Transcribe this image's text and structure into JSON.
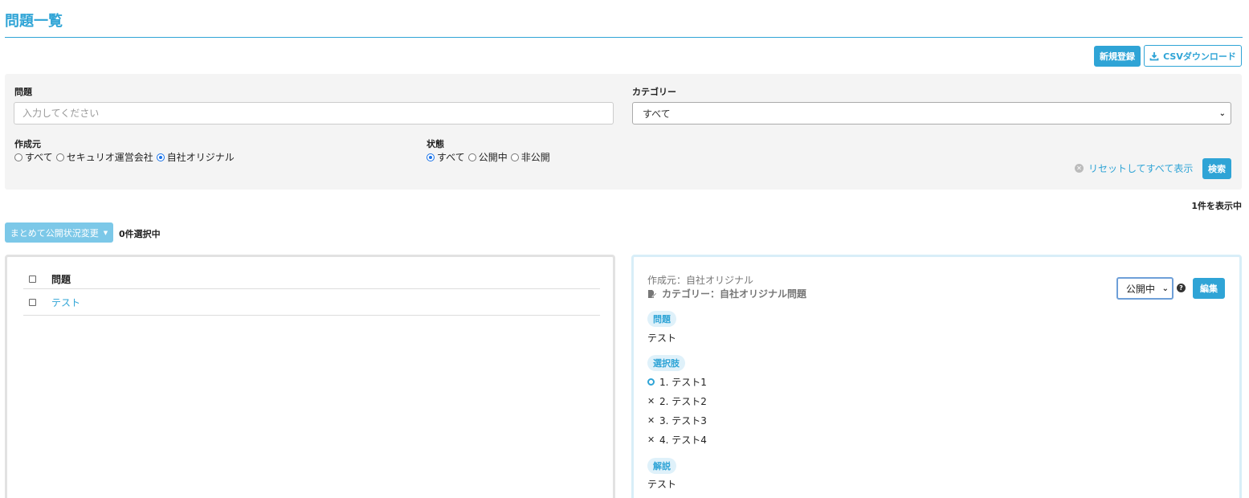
{
  "page": {
    "title": "問題一覧"
  },
  "toolbar": {
    "new_label": "新規登録",
    "csv_label": "CSVダウンロード"
  },
  "search": {
    "question_label": "問題",
    "question_placeholder": "入力してください",
    "category_label": "カテゴリー",
    "category_selected": "すべて",
    "creator_label": "作成元",
    "creator_options": [
      "すべて",
      "セキュリオ運営会社",
      "自社オリジナル"
    ],
    "creator_selected_index": 2,
    "status_label": "状態",
    "status_options": [
      "すべて",
      "公開中",
      "非公開"
    ],
    "status_selected_index": 0,
    "reset_label": "リセットしてすべて表示",
    "search_label": "検索"
  },
  "results": {
    "count_text": "1件を表示中",
    "bulk_label": "まとめて公開状況変更",
    "selected_text": "0件選択中"
  },
  "list": {
    "header": "問題",
    "rows": [
      {
        "title": "テスト"
      }
    ]
  },
  "detail": {
    "creator_text": "作成元：自社オリジナル",
    "category_text": "カテゴリー：自社オリジナル問題",
    "status_selected": "公開中",
    "edit_label": "編集",
    "question_tag": "問題",
    "question_text": "テスト",
    "choices_tag": "選択肢",
    "choices": [
      {
        "text": "1. テスト1",
        "correct": true
      },
      {
        "text": "2. テスト2",
        "correct": false
      },
      {
        "text": "3. テスト3",
        "correct": false
      },
      {
        "text": "4. テスト4",
        "correct": false
      }
    ],
    "explanation_tag": "解説",
    "explanation_text": "テスト"
  },
  "colors": {
    "accent": "#2fa4d6",
    "panel_bg": "#f4f4f4"
  }
}
